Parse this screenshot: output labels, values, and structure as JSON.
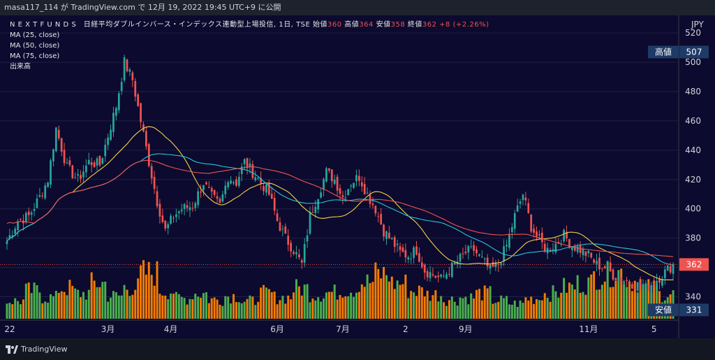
{
  "header": {
    "text": "masa117_114 が TradingView.com で 12月 19, 2022 19:45 UTC+9 に公開"
  },
  "legend": {
    "title": "N E X T   F U N D S　日経平均ダブルインバース・インデックス連動型上場投信, 1日, TSE",
    "open_label": "始値",
    "open": "360",
    "high_label": "高値",
    "high": "364",
    "low_label": "安値",
    "low": "358",
    "close_label": "終値",
    "close": "362",
    "change": "+8 (+2.26%)",
    "ma": [
      "MA (25, close)",
      "MA (50, close)",
      "MA (75, close)"
    ],
    "volume": "出来高"
  },
  "brand": {
    "name": "TradingView"
  },
  "colors": {
    "up": "#26a69a",
    "down": "#ef5350",
    "vol_up": "#4caf50",
    "vol_down": "#f57c00",
    "ma25": "#f2d24b",
    "ma50": "#26c6da",
    "ma75": "#ef5350",
    "background": "#0c0a2e"
  },
  "chart_data": {
    "type": "line",
    "currency": "JPY",
    "ylim": [
      324,
      532
    ],
    "y_ticks": [
      340,
      360,
      380,
      400,
      420,
      440,
      460,
      480,
      500,
      520
    ],
    "x_ticks": [
      "22",
      "3月",
      "4月",
      "6月",
      "7月",
      "2",
      "9月",
      "11月",
      "5"
    ],
    "x_tick_index": [
      0,
      37,
      60,
      99,
      123,
      146,
      168,
      213,
      237
    ],
    "markers": [
      {
        "label": "高値",
        "value": 507,
        "color": "#1e3a66"
      },
      {
        "label": "362",
        "value": 362,
        "color": "#ef5350"
      },
      {
        "label": "安値",
        "value": 331,
        "color": "#1e3a66"
      }
    ],
    "close_anchors": [
      [
        0,
        378
      ],
      [
        4,
        392
      ],
      [
        8,
        395
      ],
      [
        12,
        408
      ],
      [
        15,
        420
      ],
      [
        18,
        455
      ],
      [
        22,
        428
      ],
      [
        26,
        420
      ],
      [
        30,
        432
      ],
      [
        34,
        430
      ],
      [
        37,
        450
      ],
      [
        40,
        470
      ],
      [
        43,
        500
      ],
      [
        46,
        488
      ],
      [
        49,
        460
      ],
      [
        52,
        432
      ],
      [
        55,
        405
      ],
      [
        58,
        385
      ],
      [
        61,
        395
      ],
      [
        64,
        400
      ],
      [
        68,
        402
      ],
      [
        72,
        418
      ],
      [
        75,
        408
      ],
      [
        78,
        402
      ],
      [
        81,
        422
      ],
      [
        84,
        418
      ],
      [
        87,
        432
      ],
      [
        90,
        425
      ],
      [
        93,
        418
      ],
      [
        96,
        410
      ],
      [
        99,
        392
      ],
      [
        102,
        380
      ],
      [
        105,
        372
      ],
      [
        108,
        362
      ],
      [
        111,
        395
      ],
      [
        114,
        410
      ],
      [
        117,
        425
      ],
      [
        120,
        420
      ],
      [
        123,
        408
      ],
      [
        126,
        418
      ],
      [
        129,
        422
      ],
      [
        132,
        410
      ],
      [
        135,
        400
      ],
      [
        138,
        385
      ],
      [
        141,
        378
      ],
      [
        144,
        370
      ],
      [
        147,
        368
      ],
      [
        150,
        372
      ],
      [
        153,
        358
      ],
      [
        156,
        355
      ],
      [
        159,
        352
      ],
      [
        162,
        358
      ],
      [
        165,
        364
      ],
      [
        168,
        370
      ],
      [
        171,
        372
      ],
      [
        174,
        365
      ],
      [
        177,
        358
      ],
      [
        180,
        362
      ],
      [
        183,
        375
      ],
      [
        186,
        395
      ],
      [
        189,
        410
      ],
      [
        192,
        388
      ],
      [
        195,
        378
      ],
      [
        198,
        372
      ],
      [
        201,
        376
      ],
      [
        204,
        382
      ],
      [
        207,
        375
      ],
      [
        210,
        372
      ],
      [
        213,
        368
      ],
      [
        216,
        362
      ],
      [
        219,
        360
      ],
      [
        222,
        355
      ],
      [
        225,
        352
      ],
      [
        228,
        350
      ],
      [
        231,
        348
      ],
      [
        234,
        346
      ],
      [
        237,
        350
      ],
      [
        240,
        355
      ],
      [
        244,
        362
      ]
    ],
    "volume_profile": [
      0.35,
      0.55,
      0.42,
      0.6,
      0.5,
      0.7,
      0.45,
      0.62,
      0.9,
      0.55,
      0.4,
      0.5,
      0.38,
      0.45,
      0.35,
      0.5,
      0.42,
      0.6,
      0.48,
      0.52,
      0.58,
      0.72,
      0.88,
      0.7,
      0.55,
      0.48,
      0.38,
      0.42,
      0.5,
      0.36,
      0.3,
      0.4,
      0.5,
      0.62,
      0.7,
      0.85,
      0.92,
      0.75,
      0.6,
      0.48
    ],
    "ma_periods": [
      25,
      50,
      75
    ]
  }
}
